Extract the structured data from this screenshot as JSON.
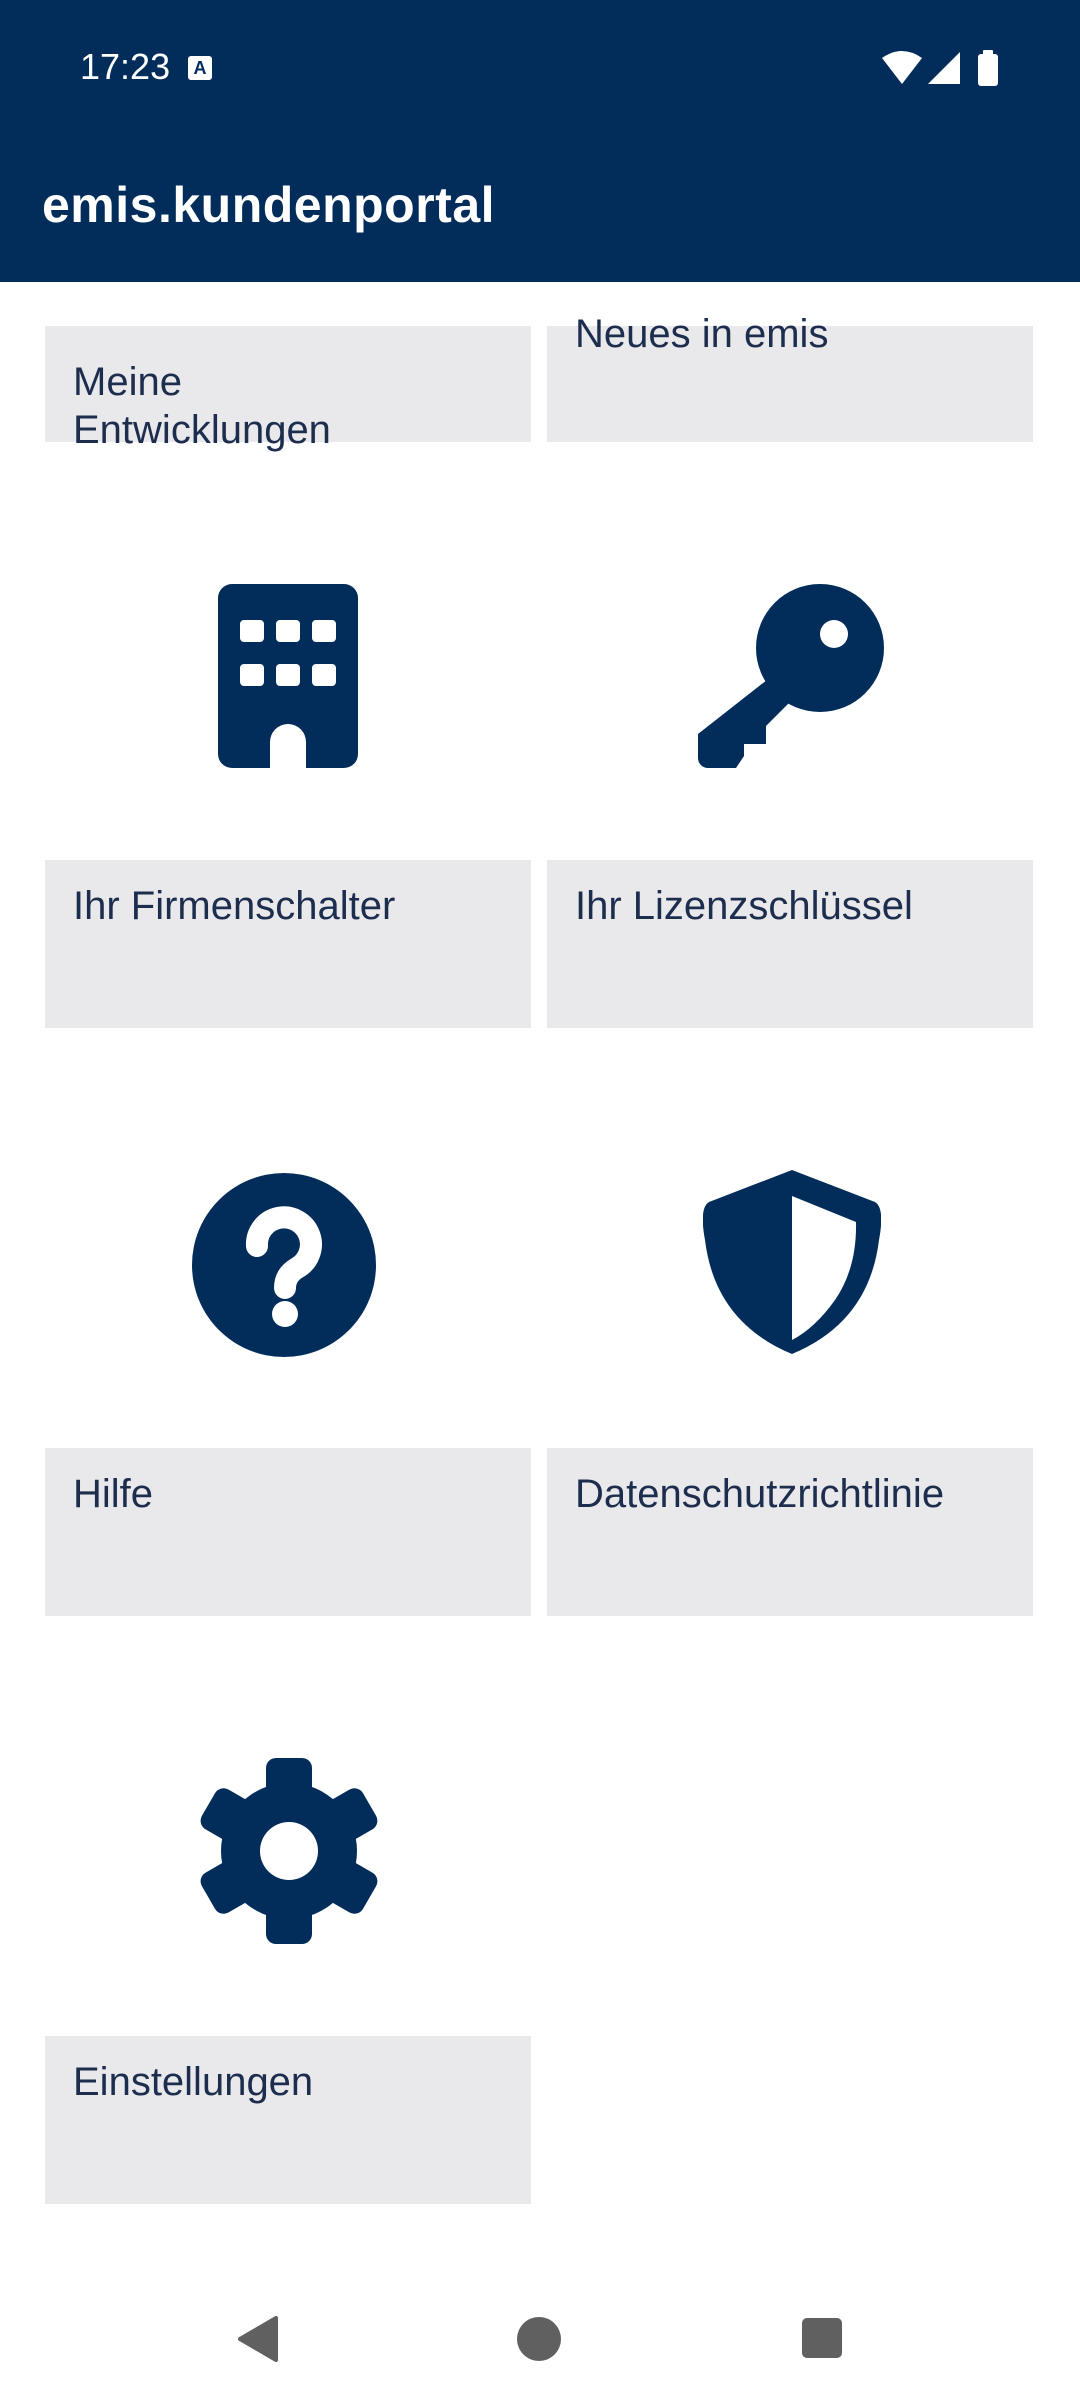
{
  "status_bar": {
    "time": "17:23",
    "notification_icon": "A",
    "icons": [
      "wifi-icon",
      "signal-icon",
      "battery-icon"
    ]
  },
  "app_bar": {
    "title": "emis.kundenportal"
  },
  "tiles": {
    "meine_entwicklungen": {
      "label": "Meine\nEntwicklungen"
    },
    "neues_in_emis": {
      "label": "Neues in emis"
    },
    "firmenschalter": {
      "label": "Ihr Firmenschalter",
      "icon": "building-icon"
    },
    "lizenzschluessel": {
      "label": "Ihr Lizenzschlüssel",
      "icon": "key-icon"
    },
    "hilfe": {
      "label": "Hilfe",
      "icon": "help-circle-icon"
    },
    "datenschutz": {
      "label": "Datenschutzrichtlinie",
      "icon": "shield-icon"
    },
    "einstellungen": {
      "label": "Einstellungen",
      "icon": "gear-icon"
    }
  },
  "nav_bar": {
    "buttons": [
      "back-icon",
      "home-icon",
      "recents-icon"
    ]
  },
  "colors": {
    "primary": "#022d5a",
    "tile_bg": "#e9e9eb",
    "text": "#1c2d4e"
  }
}
